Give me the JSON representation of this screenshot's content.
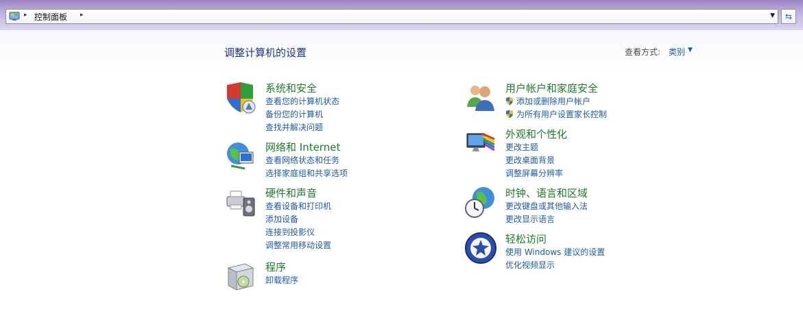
{
  "address_bar": {
    "crumb": "控制面板",
    "separator": "▸",
    "dropdown_icon": "chevron-down-icon",
    "refresh_icon": "refresh-icon"
  },
  "header": {
    "title": "调整计算机的设置",
    "view_by_label": "查看方式:",
    "view_by_value": "类别"
  },
  "categories": [
    {
      "title": "系统和安全",
      "icon": "security-shield-icon",
      "links": [
        "查看您的计算机状态",
        "备份您的计算机",
        "查找并解决问题"
      ]
    },
    {
      "title": "网络和 Internet",
      "icon": "network-globe-icon",
      "links": [
        "查看网络状态和任务",
        "选择家庭组和共享选项"
      ]
    },
    {
      "title": "硬件和声音",
      "icon": "printer-speaker-icon",
      "links": [
        "查看设备和打印机",
        "添加设备",
        "连接到投影仪",
        "调整常用移动设置"
      ]
    },
    {
      "title": "程序",
      "icon": "programs-box-icon",
      "links": [
        "卸载程序"
      ]
    },
    {
      "title": "用户帐户和家庭安全",
      "icon": "users-icon",
      "links": [
        "添加或删除用户帐户",
        "为所有用户设置家长控制"
      ]
    },
    {
      "title": "外观和个性化",
      "icon": "monitor-palette-icon",
      "links": [
        "更改主题",
        "更改桌面背景",
        "调整屏幕分辨率"
      ]
    },
    {
      "title": "时钟、语言和区域",
      "icon": "clock-globe-icon",
      "links": [
        "更改键盘或其他输入法",
        "更改显示语言"
      ]
    },
    {
      "title": "轻松访问",
      "icon": "ease-of-access-icon",
      "links": [
        "使用 Windows 建议的设置",
        "优化视频显示"
      ]
    }
  ],
  "colors": {
    "category_title": "#1e7a2c",
    "link": "#1e5aa8",
    "page_title": "#1e3287"
  }
}
